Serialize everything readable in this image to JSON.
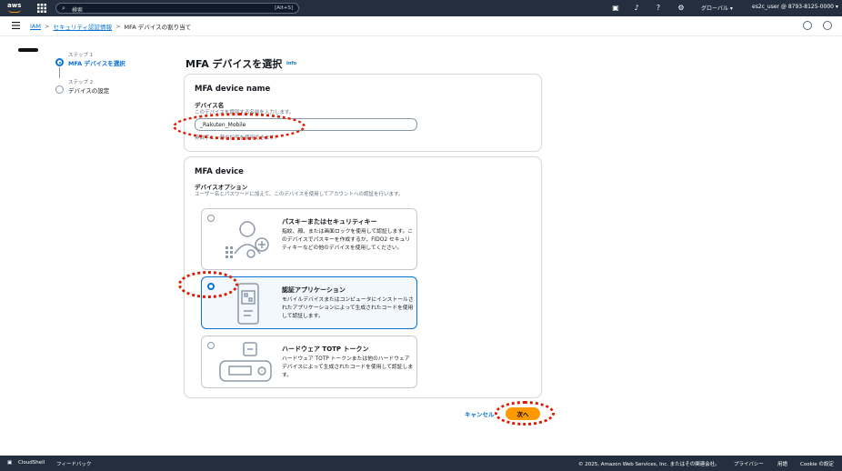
{
  "topbar": {
    "logo": "aws",
    "search_placeholder": "検索",
    "search_shortcut": "[Alt+S]",
    "icons": [
      "cloudshell-icon",
      "bell-icon",
      "help-icon",
      "gear-icon"
    ],
    "region": "グローバル ▾",
    "account": "es2c_user @ 8793-8125-0000 ▾"
  },
  "breadcrumb": {
    "items": [
      "IAM",
      "セキュリティ認証情報",
      "MFA デバイスの割り当て"
    ],
    "separator": ">"
  },
  "steps": [
    {
      "number": "ステップ 1",
      "title": "MFA デバイスを選択",
      "active": true
    },
    {
      "number": "ステップ 2",
      "title": "デバイスの設定",
      "active": false
    }
  ],
  "page": {
    "title": "MFA デバイスを選択",
    "info": "Info"
  },
  "name_card": {
    "heading": "MFA device name",
    "label": "デバイス名",
    "description": "このデバイスを識別する名前を入力します。",
    "value": "_Rakuten_Mobile",
    "constraint": "英数字と一部の記号を使用できます。"
  },
  "device_card": {
    "heading": "MFA device",
    "label": "デバイスオプション",
    "description": "ユーザー名とパスワードに加えて、このデバイスを使用してアカウントへの認証を行います。",
    "options": [
      {
        "title": "パスキーまたはセキュリティキー",
        "desc": "指紋、顔、または画面ロックを使用して認証します。このデバイスでパスキーを作成するか、FIDO2 セキュリティキーなどの他のデバイスを使用してください。",
        "selected": false
      },
      {
        "title": "認証アプリケーション",
        "desc": "モバイルデバイスまたはコンピュータにインストールされたアプリケーションによって生成されたコードを使用して認証します。",
        "selected": true
      },
      {
        "title": "ハードウェア TOTP トークン",
        "desc": "ハードウェア TOTP トークンまたは他のハードウェアデバイスによって生成されたコードを使用して認証します。",
        "selected": false
      }
    ]
  },
  "actions": {
    "cancel": "キャンセル",
    "next": "次へ"
  },
  "footer": {
    "cloudshell": "CloudShell",
    "feedback": "フィードバック",
    "copyright": "© 2025, Amazon Web Services, Inc. またはその関連会社。",
    "privacy": "プライバシー",
    "terms": "用語",
    "cookie": "Cookie の設定"
  },
  "colors": {
    "topbar": "#232f3e",
    "link": "#0972d3",
    "primary_button": "#ff9900",
    "annotation": "#e01b00"
  }
}
